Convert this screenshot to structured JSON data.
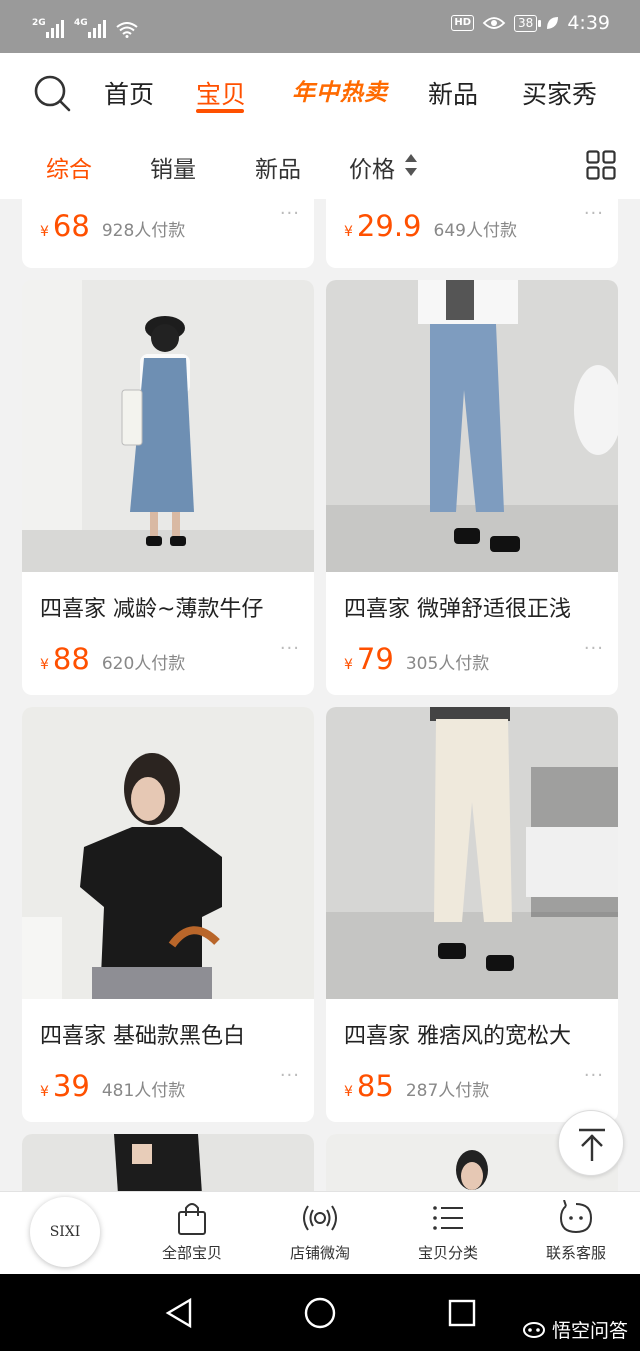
{
  "status_bar": {
    "signal_1_tag": "2G",
    "signal_2_tag": "4G",
    "hd_badge": "HD",
    "battery": "38",
    "time": "4:39"
  },
  "top_nav": {
    "tabs": [
      "首页",
      "宝贝",
      "年中热卖",
      "新品",
      "买家秀"
    ],
    "active_tab": "宝贝"
  },
  "sort_bar": {
    "items": [
      "综合",
      "销量",
      "新品",
      "价格"
    ],
    "active": "综合"
  },
  "products": [
    {
      "title": "",
      "price": "68",
      "sales": "928人付款"
    },
    {
      "title": "",
      "price": "29.9",
      "sales": "649人付款"
    },
    {
      "title": "四喜家 减龄~薄款牛仔",
      "price": "88",
      "sales": "620人付款"
    },
    {
      "title": "四喜家 微弹舒适很正浅",
      "price": "79",
      "sales": "305人付款"
    },
    {
      "title": "四喜家 基础款黑色白",
      "price": "39",
      "sales": "481人付款"
    },
    {
      "title": "四喜家 雅痞风的宽松大",
      "price": "85",
      "sales": "287人付款"
    }
  ],
  "currency_symbol": "¥",
  "more_glyph": "···",
  "bottom_bar": {
    "logo_text": "SIXI",
    "items": [
      {
        "label": "全部宝贝",
        "icon": "bag-icon"
      },
      {
        "label": "店铺微淘",
        "icon": "broadcast-icon"
      },
      {
        "label": "宝贝分类",
        "icon": "list-icon"
      },
      {
        "label": "联系客服",
        "icon": "chat-icon"
      }
    ]
  },
  "watermark": "悟空问答",
  "colors": {
    "accent": "#ff5000",
    "promo": "#ff6a00",
    "status_bar_bg": "#9a9a9a"
  }
}
